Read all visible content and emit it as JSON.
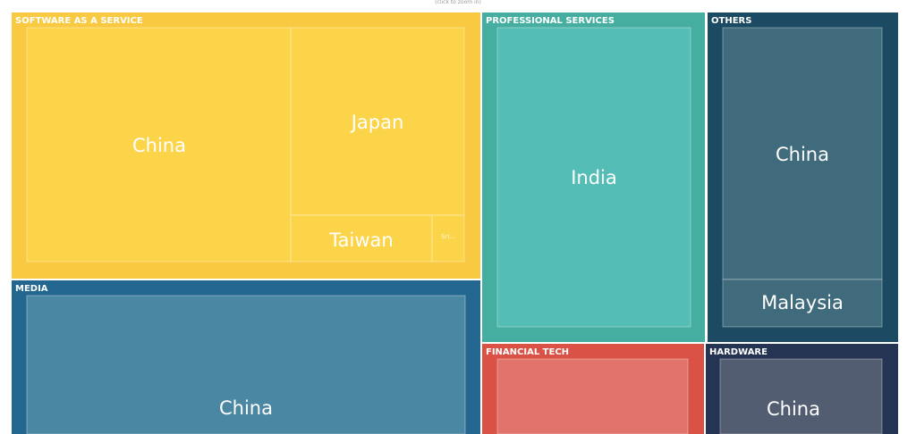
{
  "hint_text": "(click to zoom in)",
  "chart_data": {
    "type": "treemap",
    "categories": [
      {
        "name": "SOFTWARE AS A SERVICE",
        "color": "#f9c941",
        "leaf_color": "#fcd44a",
        "children": [
          {
            "name": "China",
            "value": 40
          },
          {
            "name": "Japan",
            "value": 20
          },
          {
            "name": "Taiwan",
            "value": 8
          },
          {
            "name": "Sri...",
            "value": 2
          }
        ]
      },
      {
        "name": "MEDIA",
        "color": "#236690",
        "leaf_color": "#4a87a3",
        "children": [
          {
            "name": "China",
            "value": 40
          }
        ]
      },
      {
        "name": "PROFESSIONAL SERVICES",
        "color": "#45aea0",
        "leaf_color": "#53bdb6",
        "children": [
          {
            "name": "India",
            "value": 38
          }
        ]
      },
      {
        "name": "OTHERS",
        "color": "#1b4a62",
        "leaf_color": "#3f6b7c",
        "children": [
          {
            "name": "China",
            "value": 17
          },
          {
            "name": "Malaysia",
            "value": 4
          }
        ]
      },
      {
        "name": "FINANCIAL TECH",
        "color": "#d95245",
        "leaf_color": "#e1736b",
        "children": [
          {
            "name": "",
            "value": 11
          }
        ]
      },
      {
        "name": "HARDWARE",
        "color": "#253452",
        "leaf_color": "#535d71",
        "children": [
          {
            "name": "China",
            "value": 8
          }
        ]
      }
    ]
  }
}
